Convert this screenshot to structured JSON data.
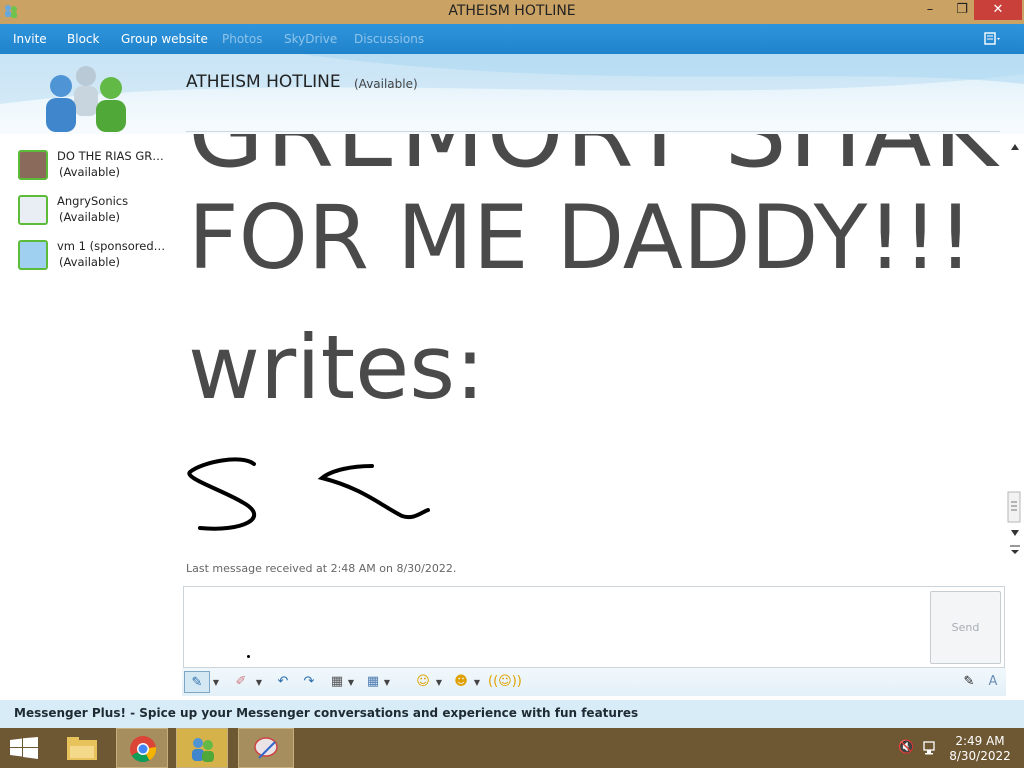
{
  "window": {
    "title": "ATHEISM HOTLINE",
    "min": "–",
    "max": "❐",
    "close": "✕"
  },
  "menu": {
    "items": [
      {
        "label": "Invite",
        "enabled": true
      },
      {
        "label": "Block",
        "enabled": true
      },
      {
        "label": "Group website",
        "enabled": true
      },
      {
        "label": "Photos",
        "enabled": false
      },
      {
        "label": "SkyDrive",
        "enabled": false
      },
      {
        "label": "Discussions",
        "enabled": false
      }
    ]
  },
  "chat": {
    "title": "ATHEISM HOTLINE",
    "status": "(Available)"
  },
  "contacts": [
    {
      "name": "DO THE RIAS GRE...",
      "status": "(Available)"
    },
    {
      "name": "AngrySonics",
      "status": "(Available)"
    },
    {
      "name": "vm 1 (sponsored ...",
      "status": "(Available)"
    }
  ],
  "history": {
    "lines": [
      "GREMORY SHAKER",
      "FOR ME DADDY!!!",
      "writes:"
    ]
  },
  "last_message": "Last message received at 2:48 AM on 8/30/2022.",
  "send_label": "Send",
  "plus_banner": "Messenger Plus! - Spice up your Messenger conversations and experience with fun features",
  "clock": {
    "time": "2:49 AM",
    "date": "8/30/2022"
  },
  "colors": {
    "menubar": "#1f83cc",
    "taskbar": "#6e5733",
    "titlebar": "#c9a264",
    "accent_green": "#5cbc3a"
  }
}
